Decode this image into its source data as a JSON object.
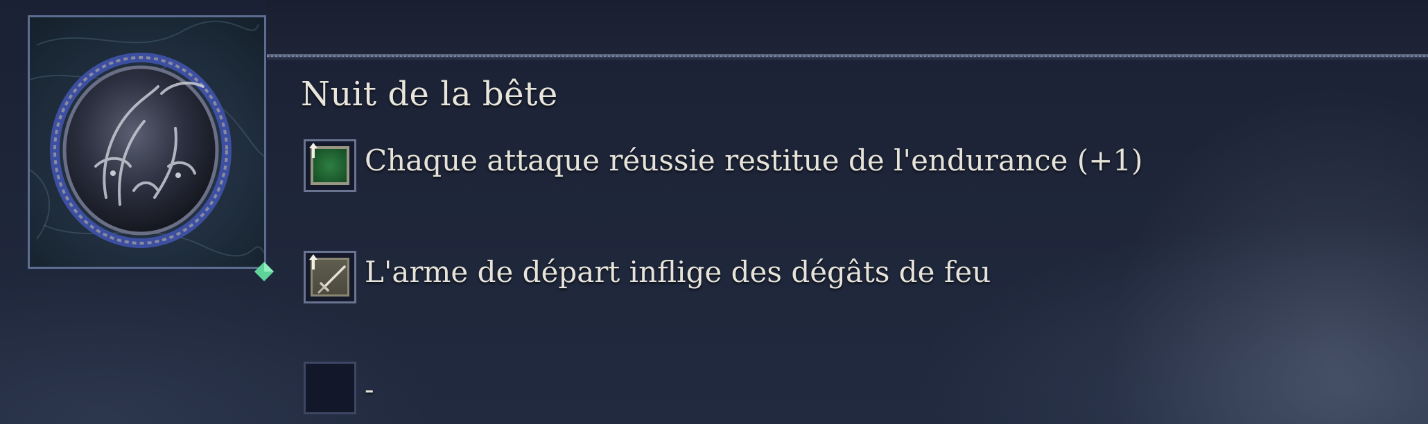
{
  "relic": {
    "title": "Nuit de la bête",
    "image_icon": "beast-seal-relic-icon",
    "rarity_gem_icon": "diamond-gem-icon",
    "accent_gem_color": "#5fd39a"
  },
  "effects": [
    {
      "icon": "green-square-stamina-icon",
      "upgrade_icon": "up-arrow-icon",
      "text": "Chaque attaque réussie restitue de l'endurance (+1)"
    },
    {
      "icon": "sword-icon",
      "upgrade_icon": "up-arrow-icon",
      "text": "L'arme de départ inflige des dégâts de feu"
    },
    {
      "icon": "empty-slot-icon",
      "text": "-"
    }
  ]
}
